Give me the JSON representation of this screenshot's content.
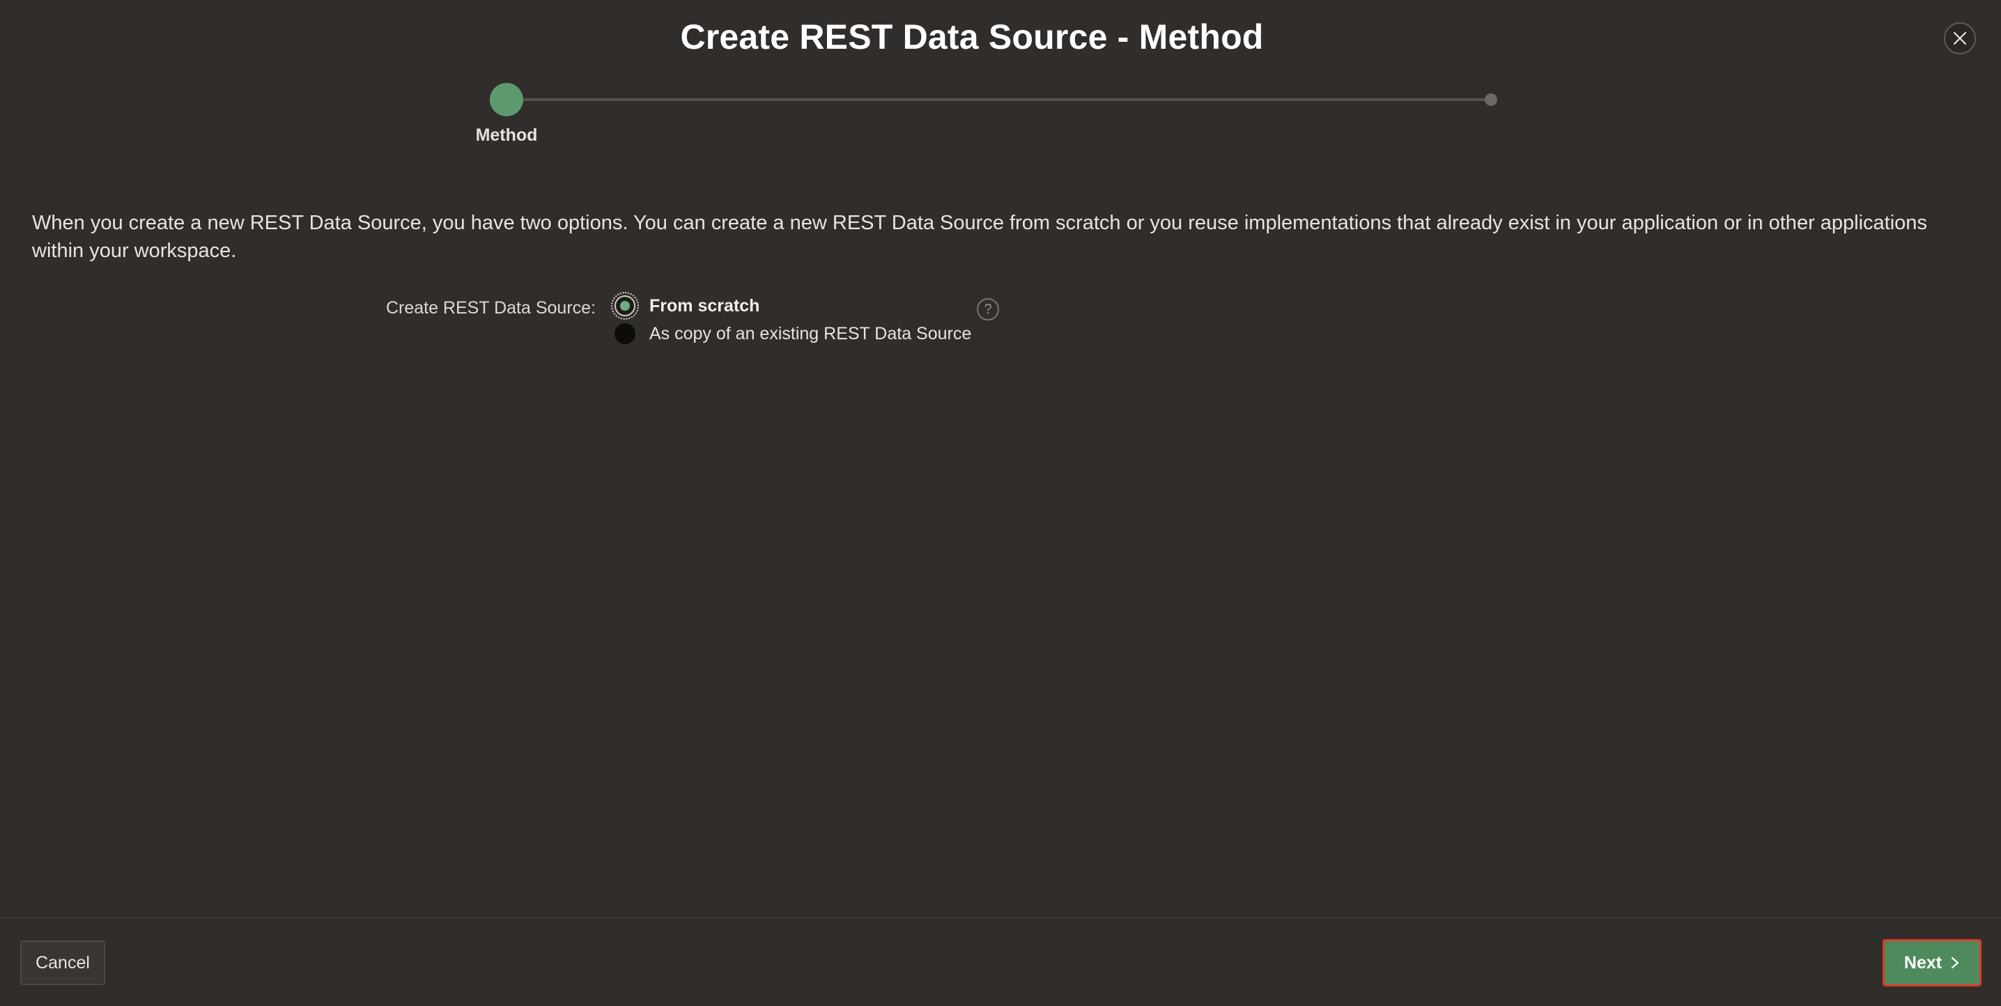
{
  "dialog": {
    "title": "Create REST Data Source - Method",
    "close_icon": "close-icon"
  },
  "wizard": {
    "steps": [
      {
        "label": "Method",
        "state": "active"
      },
      {
        "label": "",
        "state": "pending"
      }
    ],
    "active_color": "#5c9a6e"
  },
  "main": {
    "description": "When you create a new REST Data Source, you have two options. You can create a new REST Data Source from scratch or you reuse implementations that already exist in your application or in other applications within your workspace.",
    "field_label": "Create REST Data Source:",
    "options": [
      {
        "label": "From scratch",
        "selected": true
      },
      {
        "label": "As copy of an existing REST Data Source",
        "selected": false
      }
    ],
    "help_icon": "help-icon",
    "help_glyph": "?"
  },
  "footer": {
    "cancel_label": "Cancel",
    "next_label": "Next",
    "next_icon": "chevron-right-icon",
    "next_color": "#4e8a5c",
    "highlight_color": "#e0392b"
  }
}
